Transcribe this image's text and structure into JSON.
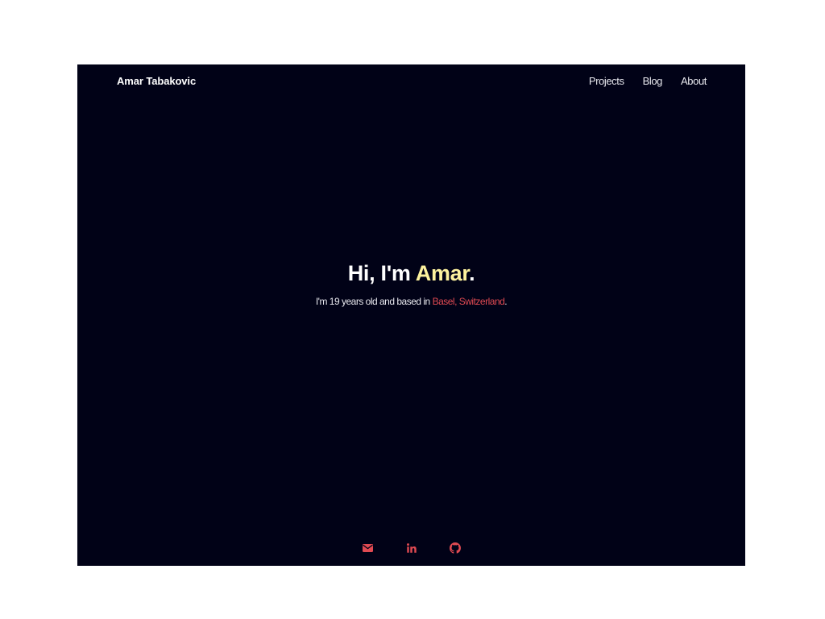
{
  "navbar": {
    "brand": "Amar Tabakovic",
    "links": [
      {
        "label": "Projects"
      },
      {
        "label": "Blog"
      },
      {
        "label": "About"
      }
    ]
  },
  "hero": {
    "greeting": "Hi, I'm ",
    "name": "Amar",
    "greeting_end": ".",
    "subtitle_prefix": "I'm 19 years old and based in ",
    "location": "Basel, Switzerland",
    "subtitle_suffix": "."
  },
  "socials": [
    {
      "icon": "envelope-icon"
    },
    {
      "icon": "linkedin-icon"
    },
    {
      "icon": "github-icon"
    }
  ],
  "colors": {
    "background": "#010217",
    "accent_yellow": "#fdf29e",
    "accent_red": "#e04a52",
    "text": "#e8e8ee"
  }
}
